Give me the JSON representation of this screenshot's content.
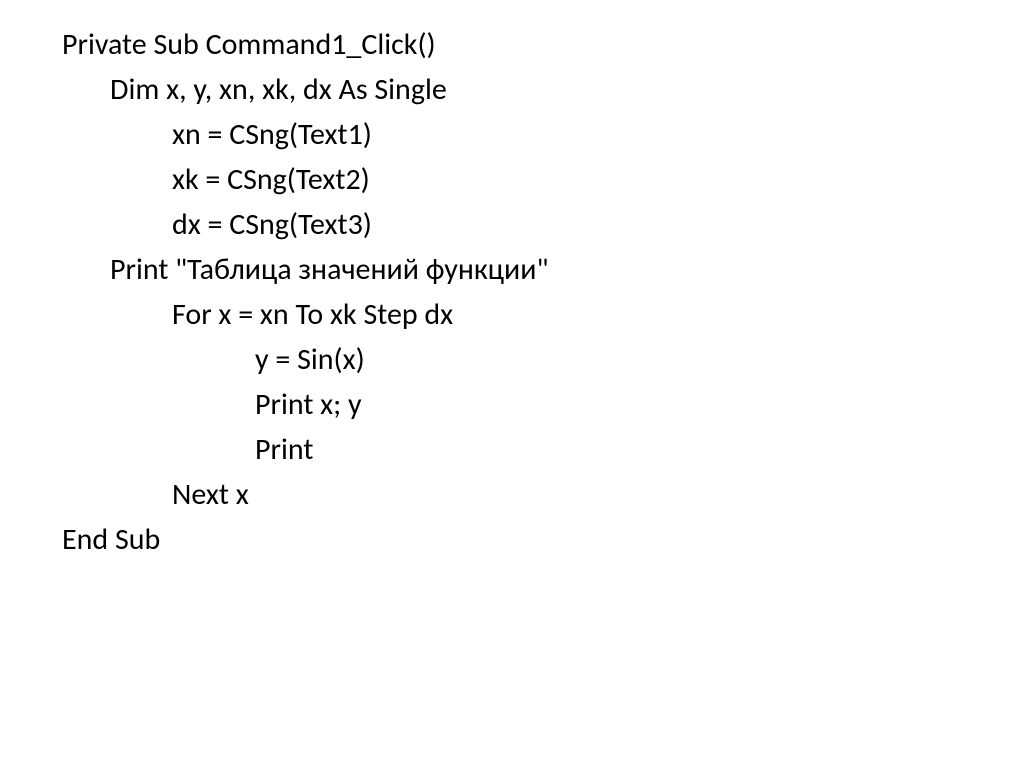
{
  "code": {
    "l1": "Private Sub Command1_Click()",
    "l2": "Dim x, y, xn, xk, dx As Single",
    "l3": "xn = CSng(Text1)",
    "l4": "xk = CSng(Text2)",
    "l5": "dx = CSng(Text3)",
    "l6": "Print \"Таблица значений функции\"",
    "l7": "For x = xn To xk Step dx",
    "l8": "y = Sin(x)",
    "l9": "Print x; y",
    "l10": "Print",
    "l11": "Next x",
    "l12": "End Sub"
  }
}
